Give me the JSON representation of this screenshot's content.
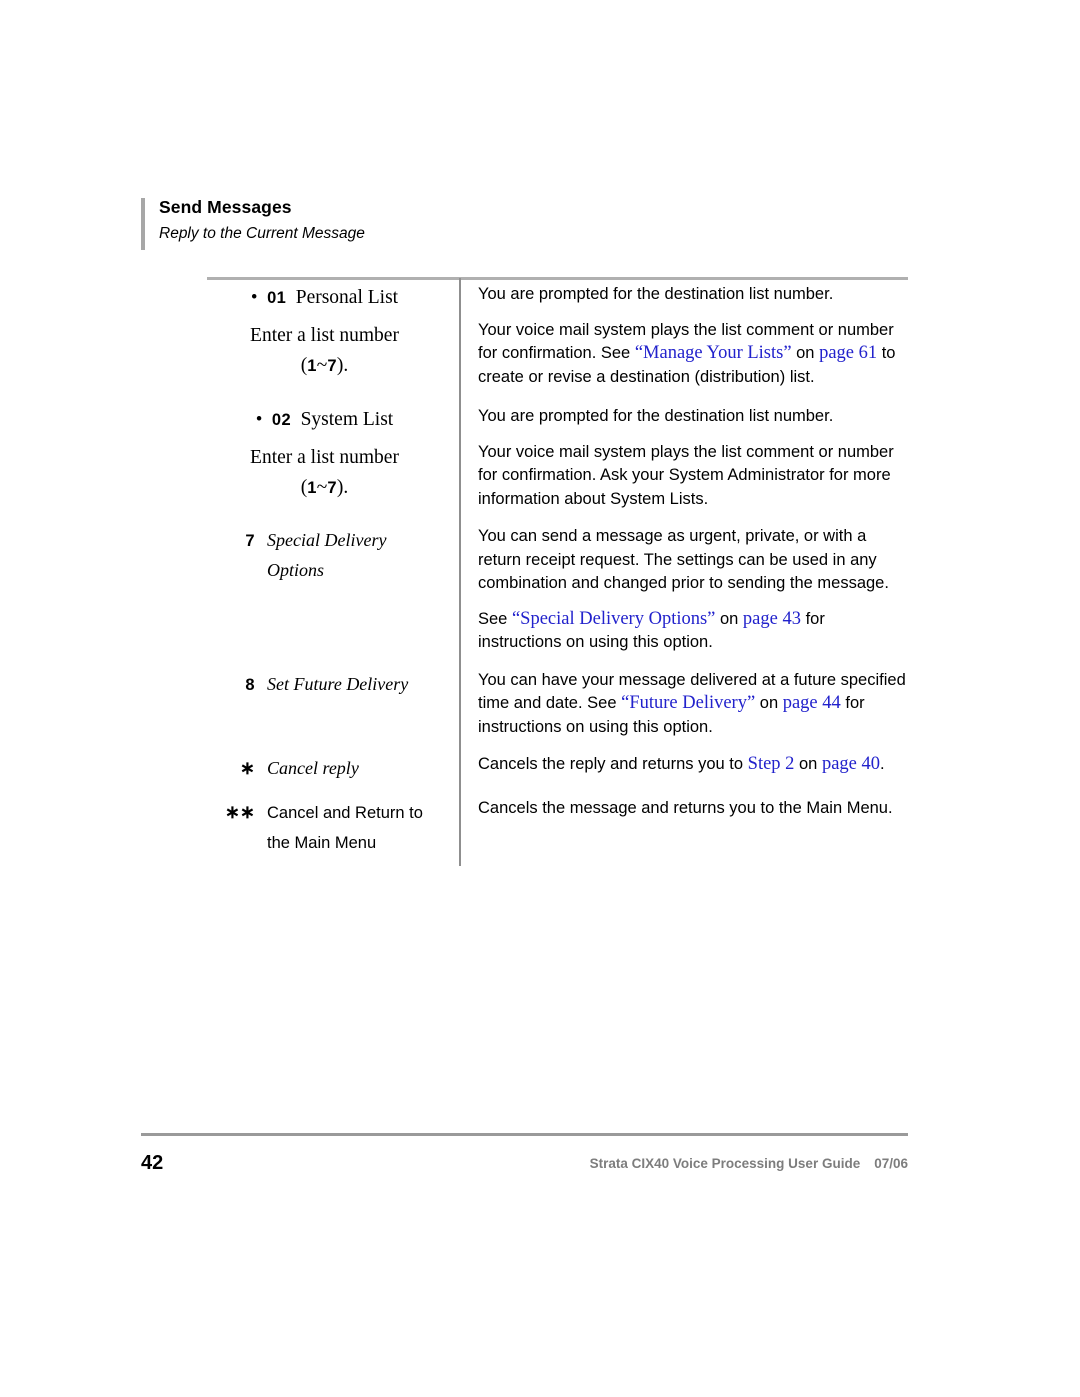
{
  "header": {
    "title": "Send Messages",
    "subtitle": "Reply to the Current Message"
  },
  "table": {
    "rows": [
      {
        "id": "personal-list",
        "symbol": "•",
        "digits": "01",
        "label": "Personal List",
        "sub_line_1": "Enter a list number",
        "sub_open_paren": "(",
        "sub_digit_low": "1",
        "sub_tilde": "~",
        "sub_digit_high": "7",
        "sub_close_paren": ").",
        "desc_1": "You are prompted for the destination list number.",
        "desc_2_a": "Your voice mail system plays the list comment or number for confirmation. See ",
        "desc_2_link_1": "“Manage Your Lists”",
        "desc_2_b": " on ",
        "desc_2_link_2": "page 61",
        "desc_2_c": " to create or revise a destination (distribution) list."
      },
      {
        "id": "system-list",
        "symbol": "•",
        "digits": "02",
        "label": "System List",
        "sub_line_1": "Enter a list number",
        "sub_open_paren": "(",
        "sub_digit_low": "1",
        "sub_tilde": "~",
        "sub_digit_high": "7",
        "sub_close_paren": ").",
        "desc_1": "You are prompted for the destination list number.",
        "desc_2": "Your voice mail system plays the list comment or number for confirmation. Ask your System Administrator for more information about System Lists."
      },
      {
        "id": "special-delivery-options",
        "symbol": "7",
        "label_line_1": "Special Delivery",
        "label_line_2": "Options",
        "desc_1": "You can send a message as urgent, private, or with a return receipt request. The settings can be used in any combination and changed prior to sending the message.",
        "desc_2_a": "See ",
        "desc_2_link_1": "“Special Delivery Options”",
        "desc_2_b": " on ",
        "desc_2_link_2": "page 43",
        "desc_2_c": " for instructions on using this option."
      },
      {
        "id": "set-future-delivery",
        "symbol": "8",
        "label": "Set Future Delivery",
        "desc_a": "You can have your message delivered at a future specified time and date. See ",
        "desc_link_1": "“Future Delivery”",
        "desc_b": " on ",
        "desc_link_2": "page 44",
        "desc_c": " for instructions on using this option."
      },
      {
        "id": "cancel-reply",
        "symbol": "∗",
        "label": "Cancel reply",
        "desc_a": "Cancels the reply and returns you to ",
        "desc_link_1": "Step 2",
        "desc_b": " on ",
        "desc_link_2": "page 40",
        "desc_c": "."
      },
      {
        "id": "cancel-return-main-menu",
        "symbol": "∗∗",
        "label_line_1": "Cancel and Return to",
        "label_line_2": "the Main Menu",
        "desc": "Cancels the message and returns you to the Main Menu."
      }
    ]
  },
  "footer": {
    "page_number": "42",
    "guide_title": "Strata CIX40 Voice Processing User Guide",
    "date": "07/06"
  },
  "colors": {
    "link": "#2222cc",
    "rule": "#b0b0b0",
    "footer_text": "#7d7d7d"
  }
}
